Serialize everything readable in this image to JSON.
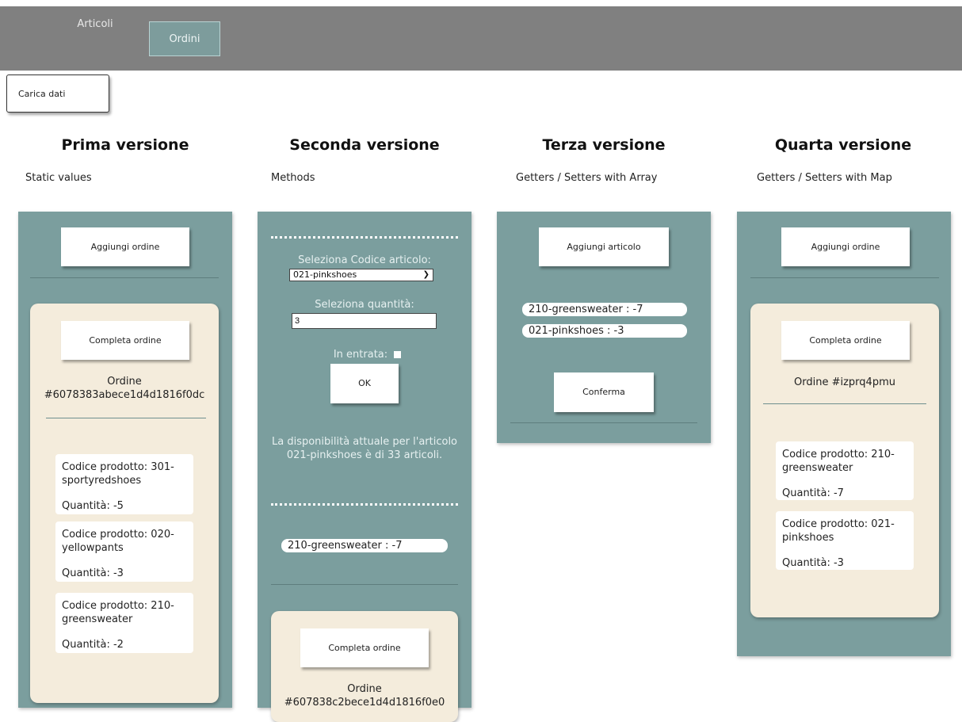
{
  "nav": {
    "items": [
      {
        "label": "Articoli"
      },
      {
        "label": "Ordini"
      }
    ]
  },
  "load_button": "Carica dati",
  "columns": [
    {
      "title": "Prima versione",
      "subtitle": "Static values",
      "add_button": "Aggiungi ordine",
      "complete_button": "Completa ordine",
      "order_title": "Ordine\n#6078383abece1d4d1816f0dc",
      "items": [
        {
          "code": "Codice prodotto: 301-sportyredshoes",
          "qty": "Quantità: -5"
        },
        {
          "code": "Codice prodotto: 020-yellowpants",
          "qty": "Quantità: -3"
        },
        {
          "code": "Codice prodotto: 210-greensweater",
          "qty": "Quantità: -2"
        }
      ]
    },
    {
      "title": "Seconda versione",
      "subtitle": "Methods",
      "select_label": "Seleziona Codice articolo:",
      "select_value": "021-pinkshoes",
      "qty_label": "Seleziona quantità:",
      "qty_value": "3",
      "incoming_label": "In entrata:",
      "ok_button": "OK",
      "availability": "La disponibilità attuale per l'articolo 021-pinkshoes è di 33 articoli.",
      "pill": "210-greensweater : -7",
      "complete_button": "Completa ordine",
      "order_title": "Ordine\n#607838c2bece1d4d1816f0e0"
    },
    {
      "title": "Terza versione",
      "subtitle": "Getters / Setters with Array",
      "add_button": "Aggiungi articolo",
      "pills": [
        "210-greensweater : -7",
        "021-pinkshoes : -3"
      ],
      "confirm_button": "Conferma"
    },
    {
      "title": "Quarta versione",
      "subtitle": "Getters / Setters with Map",
      "add_button": "Aggiungi ordine",
      "complete_button": "Completa ordine",
      "order_title": "Ordine #izprq4pmu",
      "items": [
        {
          "code": "Codice prodotto: 210-greensweater",
          "qty": "Quantità: -7"
        },
        {
          "code": "Codice prodotto: 021-pinkshoes",
          "qty": "Quantità: -3"
        }
      ]
    }
  ],
  "colors": {
    "topbar": "#808080",
    "panel": "#7b9e9e",
    "order_card": "#f4ecdc"
  }
}
